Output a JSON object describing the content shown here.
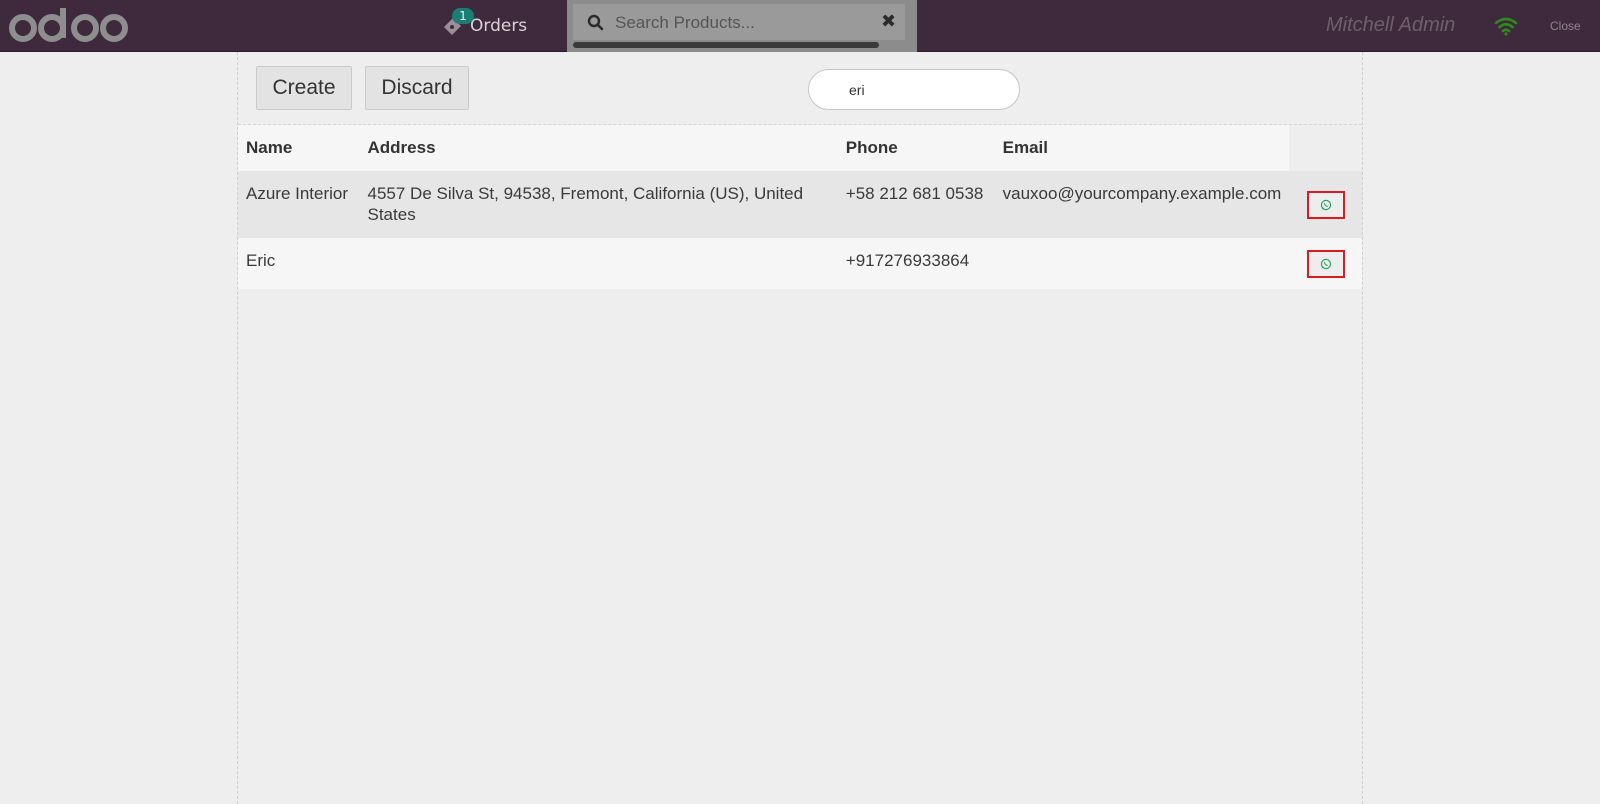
{
  "header": {
    "logo_text": "odoo",
    "orders_label": "Orders",
    "orders_count": "1",
    "search_placeholder": "Search Products...",
    "user_name": "Mitchell Admin",
    "close_label": "Close"
  },
  "toolbar": {
    "create_label": "Create",
    "discard_label": "Discard",
    "customer_search_value": "eri"
  },
  "table": {
    "columns": [
      "Name",
      "Address",
      "Phone",
      "Email"
    ],
    "rows": [
      {
        "name": "Azure Interior",
        "address": "4557 De Silva St, 94538, Fremont, California (US), United States",
        "phone": "+58 212 681 0538",
        "email": "vauxoo@yourcompany.example.com"
      },
      {
        "name": "Eric",
        "address": "",
        "phone": "+917276933864",
        "email": ""
      }
    ]
  },
  "colors": {
    "topbar": "#3f2a3d",
    "accent_badge": "#1b7e74",
    "highlight_border": "#e0191f",
    "whatsapp_green": "#25a85a"
  },
  "icons": {
    "orders": "ticket-icon",
    "search": "search-icon",
    "clear": "close-icon",
    "connection": "wifi-icon",
    "row_action": "whatsapp-icon"
  }
}
